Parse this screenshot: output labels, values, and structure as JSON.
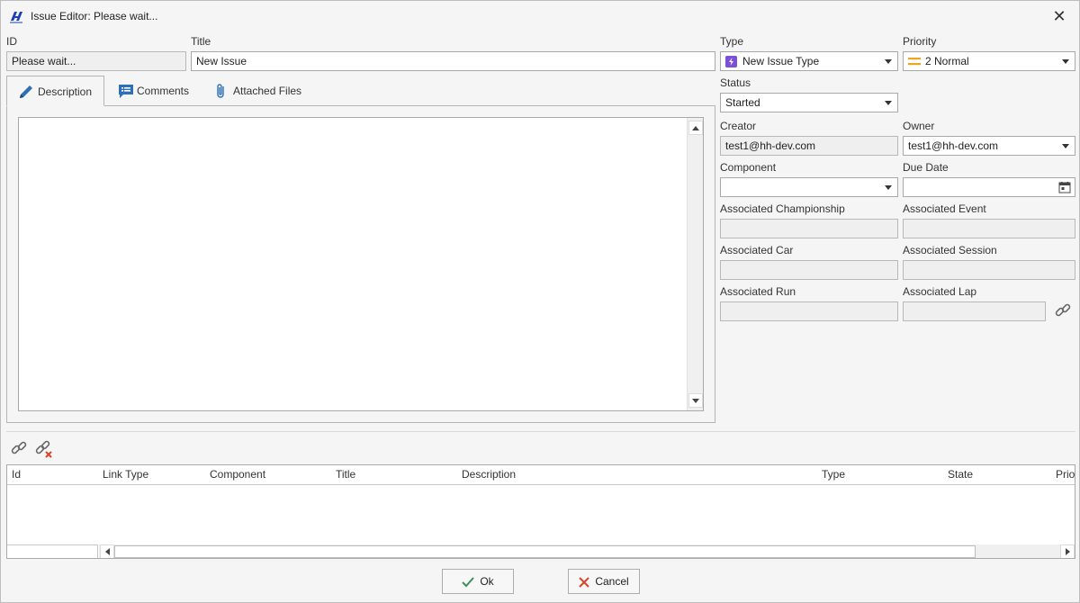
{
  "window": {
    "title": "Issue Editor: Please wait...",
    "close_glyph": "✕"
  },
  "fields": {
    "id": {
      "label": "ID",
      "value": "Please wait..."
    },
    "title": {
      "label": "Title",
      "value": "New Issue"
    },
    "type": {
      "label": "Type",
      "value": "New Issue Type"
    },
    "priority": {
      "label": "Priority",
      "value": "2 Normal"
    },
    "status": {
      "label": "Status",
      "value": "Started"
    },
    "creator": {
      "label": "Creator",
      "value": "test1@hh-dev.com"
    },
    "owner": {
      "label": "Owner",
      "value": "test1@hh-dev.com"
    },
    "component": {
      "label": "Component",
      "value": ""
    },
    "due_date": {
      "label": "Due Date",
      "value": ""
    },
    "assoc_championship": {
      "label": "Associated Championship",
      "value": ""
    },
    "assoc_event": {
      "label": "Associated Event",
      "value": ""
    },
    "assoc_car": {
      "label": "Associated Car",
      "value": ""
    },
    "assoc_session": {
      "label": "Associated Session",
      "value": ""
    },
    "assoc_run": {
      "label": "Associated Run",
      "value": ""
    },
    "assoc_lap": {
      "label": "Associated Lap",
      "value": ""
    }
  },
  "tabs": [
    {
      "label": "Description",
      "icon": "pencil-icon",
      "active": true
    },
    {
      "label": "Comments",
      "icon": "comments-icon",
      "active": false
    },
    {
      "label": "Attached Files",
      "icon": "paperclip-icon",
      "active": false
    }
  ],
  "links_grid": {
    "columns": [
      "Id",
      "Link Type",
      "Component",
      "Title",
      "Description",
      "Type",
      "State",
      "Prio"
    ],
    "rows": []
  },
  "buttons": {
    "ok": "Ok",
    "cancel": "Cancel"
  },
  "colors": {
    "type_badge": "#7b4fd6",
    "priority_icon": "#f0a31c",
    "cancel_x": "#d9442b",
    "ok_check": "#3f8f5a",
    "app_icon": "#1a3fb5"
  }
}
